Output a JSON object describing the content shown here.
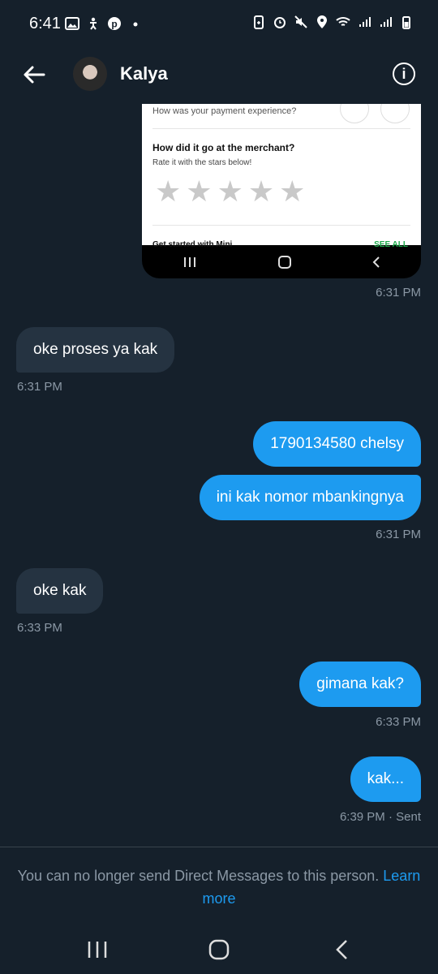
{
  "status_bar": {
    "time": "6:41",
    "left_icons": [
      "gallery-icon",
      "accessibility-icon",
      "pinterest-icon",
      "dot-icon"
    ],
    "right_icons": [
      "battery-saver-icon",
      "alarm-icon",
      "mute-icon",
      "location-icon",
      "wifi-icon",
      "signal-icon",
      "signal-icon",
      "battery-icon"
    ]
  },
  "header": {
    "contact_name": "Kalya",
    "info_label": "i"
  },
  "screenshot_preview": {
    "line1": "How was your payment experience?",
    "question": "How did it go at the merchant?",
    "subtitle": "Rate it with the stars below!",
    "stars": 5,
    "cut_text": "Get started with Mini",
    "see_all": "SEE ALL"
  },
  "messages": [
    {
      "id": "m1",
      "from": "them",
      "text": "oke proses ya kak"
    },
    {
      "id": "m2",
      "from": "me",
      "text": "1790134580 chelsy"
    },
    {
      "id": "m3",
      "from": "me",
      "text": "ini kak nomor mbankingnya"
    },
    {
      "id": "m4",
      "from": "them",
      "text": "oke kak"
    },
    {
      "id": "m5",
      "from": "me",
      "text": "gimana kak?"
    },
    {
      "id": "m6",
      "from": "me",
      "text": "kak..."
    }
  ],
  "timestamps": {
    "t_image": "6:31 PM",
    "t1": "6:31 PM",
    "t2": "6:31 PM",
    "t3": "6:33 PM",
    "t4": "6:33 PM",
    "t5": "6:39 PM · Sent"
  },
  "notice": {
    "text": "You can no longer send Direct Messages to this person.",
    "link_word1": "Learn",
    "link_word2": "more"
  },
  "colors": {
    "background": "#15202b",
    "sent_bubble": "#1d9bf0",
    "received_bubble": "#253341",
    "muted": "#8b98a5"
  }
}
